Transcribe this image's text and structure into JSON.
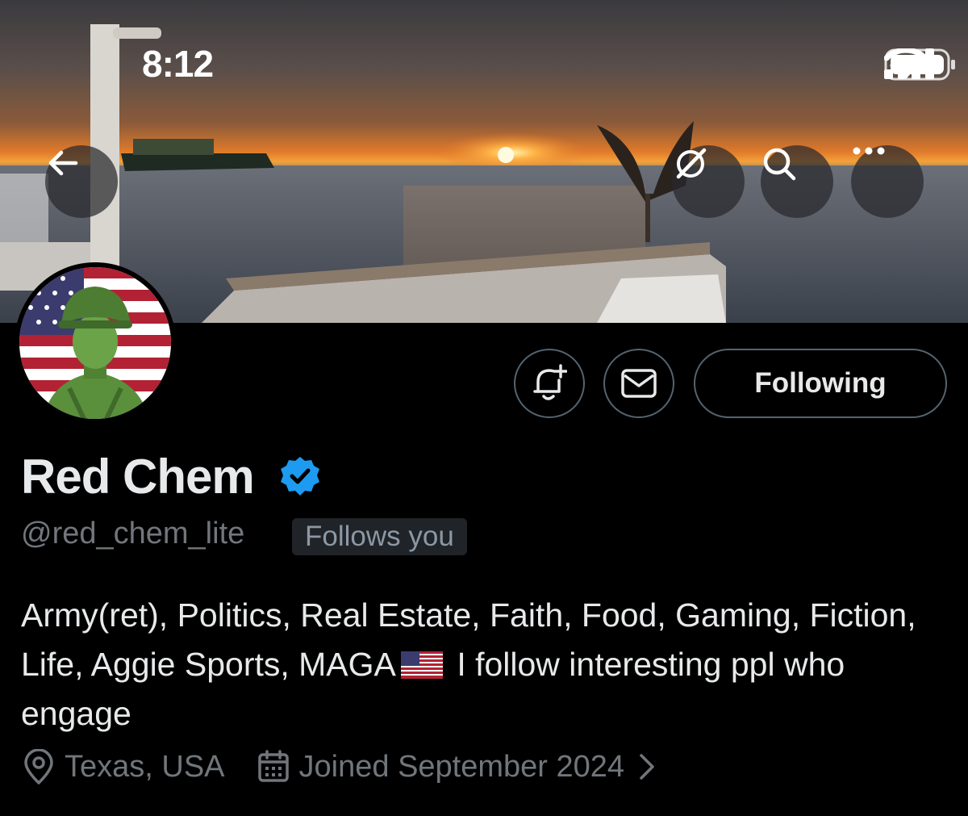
{
  "status_bar": {
    "time": "8:12"
  },
  "header": {
    "back_icon": "arrow-left-icon",
    "grok_icon": "grok-icon",
    "search_icon": "search-icon",
    "more_icon": "more-horizontal-icon"
  },
  "profile": {
    "display_name": "Red Chem",
    "verified": true,
    "handle": "@red_chem_lite",
    "follows_you": "Follows you",
    "bio_before_flag": "Army(ret), Politics, Real Estate, Faith, Food, Gaming, Fiction, Life, Aggie Sports, MAGA",
    "bio_after_flag": "I follow interesting ppl who engage",
    "location": "Texas, USA",
    "joined": "Joined September 2024"
  },
  "actions": {
    "notify_icon": "bell-plus-icon",
    "message_icon": "mail-icon",
    "following_label": "Following"
  },
  "colors": {
    "background": "#000000",
    "text_primary": "#e7e9ea",
    "text_secondary": "#71767b",
    "verified": "#1d9bf0",
    "border": "#536471"
  }
}
